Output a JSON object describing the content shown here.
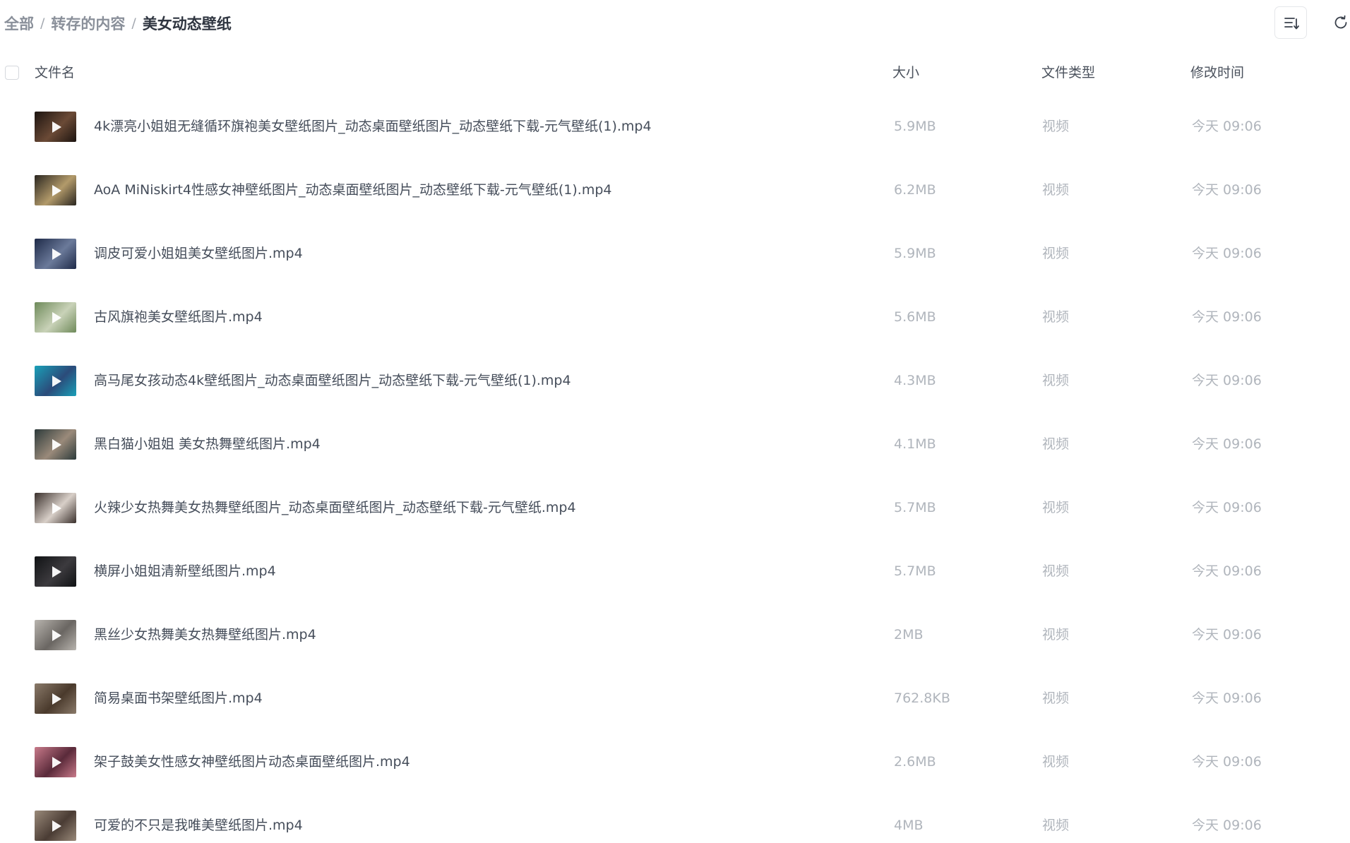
{
  "breadcrumb": {
    "items": [
      "全部",
      "转存的内容"
    ],
    "separator": "/",
    "current": "美女动态壁纸"
  },
  "toolbar": {
    "sort_icon": "sort-list-icon",
    "refresh_icon": "refresh-icon"
  },
  "table": {
    "columns": {
      "name": "文件名",
      "size": "大小",
      "type": "文件类型",
      "time": "修改时间"
    }
  },
  "files": [
    {
      "name": "4k漂亮小姐姐无缝循环旗袍美女壁纸图片_动态桌面壁纸图片_动态壁纸下载-元气壁纸(1).mp4",
      "size": "5.9MB",
      "type": "视频",
      "time": "今天 09:06",
      "thumb_colors": [
        "#1c1410",
        "#6b4a36"
      ]
    },
    {
      "name": "AoA MiNiskirt4性感女神壁纸图片_动态桌面壁纸图片_动态壁纸下载-元气壁纸(1).mp4",
      "size": "6.2MB",
      "type": "视频",
      "time": "今天 09:06",
      "thumb_colors": [
        "#2a2620",
        "#b29a6a"
      ]
    },
    {
      "name": "调皮可爱小姐姐美女壁纸图片.mp4",
      "size": "5.9MB",
      "type": "视频",
      "time": "今天 09:06",
      "thumb_colors": [
        "#1e2a48",
        "#6b7a9a"
      ]
    },
    {
      "name": "古风旗袍美女壁纸图片.mp4",
      "size": "5.6MB",
      "type": "视频",
      "time": "今天 09:06",
      "thumb_colors": [
        "#6e8a5a",
        "#c9d2b8"
      ]
    },
    {
      "name": "高马尾女孩动态4k壁纸图片_动态桌面壁纸图片_动态壁纸下载-元气壁纸(1).mp4",
      "size": "4.3MB",
      "type": "视频",
      "time": "今天 09:06",
      "thumb_colors": [
        "#1aa0b8",
        "#2b4b7a"
      ]
    },
    {
      "name": "黑白猫小姐姐 美女热舞壁纸图片.mp4",
      "size": "4.1MB",
      "type": "视频",
      "time": "今天 09:06",
      "thumb_colors": [
        "#2c3a3a",
        "#9a8a7a"
      ]
    },
    {
      "name": "火辣少女热舞美女热舞壁纸图片_动态桌面壁纸图片_动态壁纸下载-元气壁纸.mp4",
      "size": "5.7MB",
      "type": "视频",
      "time": "今天 09:06",
      "thumb_colors": [
        "#3a302c",
        "#d8cfc8"
      ]
    },
    {
      "name": "横屏小姐姐清新壁纸图片.mp4",
      "size": "5.7MB",
      "type": "视频",
      "time": "今天 09:06",
      "thumb_colors": [
        "#101214",
        "#3c3a3e"
      ]
    },
    {
      "name": "黑丝少女热舞美女热舞壁纸图片.mp4",
      "size": "2MB",
      "type": "视频",
      "time": "今天 09:06",
      "thumb_colors": [
        "#b8b4ae",
        "#6a6662"
      ]
    },
    {
      "name": "简易桌面书架壁纸图片.mp4",
      "size": "762.8KB",
      "type": "视频",
      "time": "今天 09:06",
      "thumb_colors": [
        "#8a7a6a",
        "#4a3a2c"
      ]
    },
    {
      "name": "架子鼓美女性感女神壁纸图片动态桌面壁纸图片.mp4",
      "size": "2.6MB",
      "type": "视频",
      "time": "今天 09:06",
      "thumb_colors": [
        "#c87a8a",
        "#5a2a3a"
      ]
    },
    {
      "name": "可爱的不只是我唯美壁纸图片.mp4",
      "size": "4MB",
      "type": "视频",
      "time": "今天 09:06",
      "thumb_colors": [
        "#9a8a7a",
        "#4a3c34"
      ]
    }
  ]
}
